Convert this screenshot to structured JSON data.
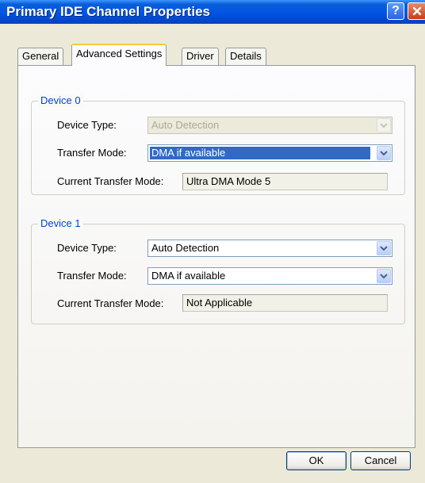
{
  "window": {
    "title": "Primary IDE Channel Properties",
    "help_label": "?"
  },
  "tabs": [
    {
      "label": "General"
    },
    {
      "label": "Advanced Settings"
    },
    {
      "label": "Driver"
    },
    {
      "label": "Details"
    }
  ],
  "active_tab": "Advanced Settings",
  "device0": {
    "group_label": "Device 0",
    "device_type_label": "Device Type:",
    "device_type_value": "Auto Detection",
    "device_type_enabled": false,
    "transfer_mode_label": "Transfer Mode:",
    "transfer_mode_value": "DMA if available",
    "current_mode_label": "Current Transfer Mode:",
    "current_mode_value": "Ultra DMA Mode 5"
  },
  "device1": {
    "group_label": "Device 1",
    "device_type_label": "Device Type:",
    "device_type_value": "Auto Detection",
    "transfer_mode_label": "Transfer Mode:",
    "transfer_mode_value": "DMA if available",
    "current_mode_label": "Current Transfer Mode:",
    "current_mode_value": "Not Applicable"
  },
  "buttons": {
    "ok": "OK",
    "cancel": "Cancel"
  },
  "colors": {
    "titlebar": "#0054e3",
    "group_label": "#0046d5",
    "selection": "#316ac5",
    "tab_highlight": "#ffc83c"
  }
}
